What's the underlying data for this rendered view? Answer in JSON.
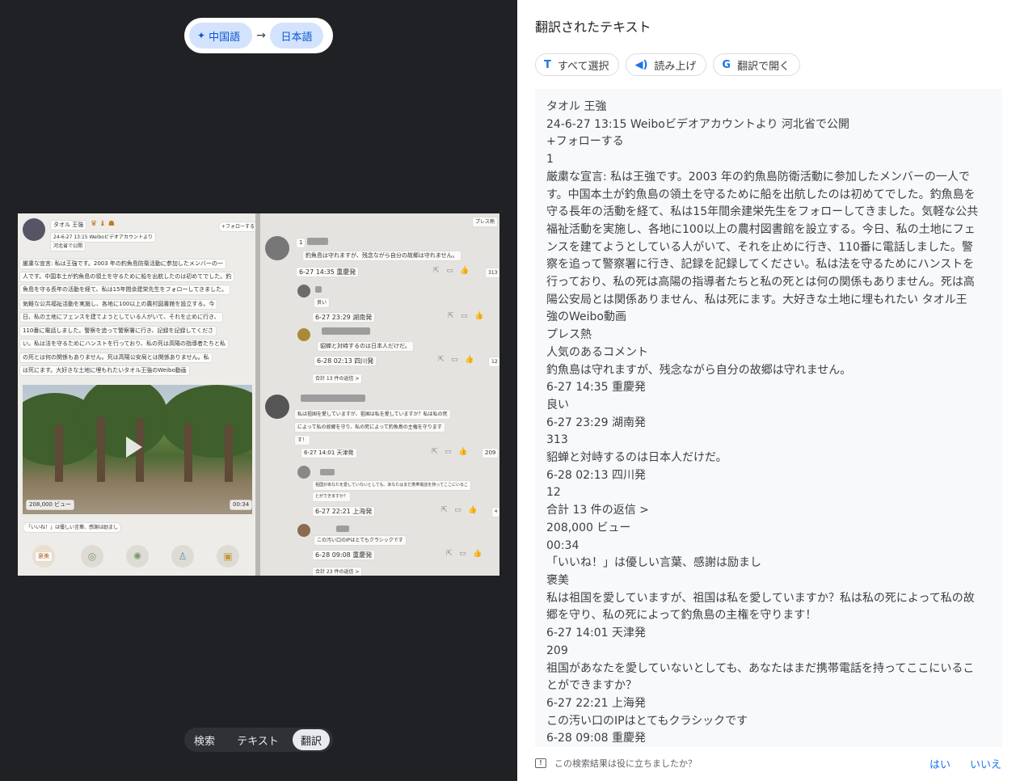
{
  "language_selector": {
    "source": "中国語",
    "arrow": "→",
    "target": "日本語"
  },
  "image_overlay": {
    "author": "タオル 王強",
    "meta": "24-6-27 13:15 Weiboビデオアカウントより",
    "location": "河北省で公開",
    "follow": "+フォローする",
    "post_lines": [
      "厳粛な宣言: 私は王強です。2003 年の釣魚島防衛活動に参加したメンバーの一",
      "人です。中国本土が釣魚島の領土を守るために船を出航したのは初めてでした。釣",
      "魚島を守る長年の活動を経て、私は15年間余建栄先生をフォローしてきました。",
      "気軽な公共福祉活動を実施し、各地に100以上の農村図書館を設立する。今",
      "日、私の土地にフェンスを建てようとしている人がいて、それを止めに行き、",
      "110番に電話しました。警察を追って警察署に行き、記録を記録してくださ",
      "い。私は法を守るためにハンストを行っており、私の死は高陽の指導者たちと私",
      "の死とは何の関係もありません。死は高陽公安局とは関係ありません。私",
      "は死にます。大好きな土地に埋もれたいタオル王強のWeibo動画"
    ],
    "views": "208,000 ビュー",
    "duration": "00:34",
    "like_caption": "「いいね！」は優しい言葉、感謝は励まし",
    "praise": "褒美",
    "hot": "プレス熱",
    "comments": [
      {
        "rank": "1",
        "text": "釣魚島は守れますが、残念ながら自分の故郷は守れません。",
        "meta": "6-27 14:35 重慶発",
        "count": "313"
      },
      {
        "text": "良い",
        "meta": "6-27 23:29 湖南発",
        "count": ""
      },
      {
        "text": "貂蝉と対峙するのは日本人だけだ。",
        "meta": "6-28 02:13 四川発",
        "count": "12"
      },
      {
        "text": "合計 13 件の返信 >",
        "meta": "",
        "count": ""
      },
      {
        "text": "私は祖国を愛していますが、祖国は私を愛していますか？私は私の死",
        "text2": "によって私の故郷を守り、私の死によって釣魚島の主権を守ります",
        "text3": "す！",
        "meta": "6-27 14:01 天津発",
        "count": "209"
      },
      {
        "text": "祖国があなたを愛していないとしても、あなたはまだ携帯電話を持ってここにいるこ",
        "text2": "とができますか？",
        "meta": "6-27 22:21 上海発",
        "count": "4"
      },
      {
        "text": "この汚い口のIPはとてもクラシックです",
        "meta": "6-28 09:08 重慶発",
        "count": ""
      },
      {
        "text": "合計 23 件の返信 >",
        "meta": "",
        "count": ""
      }
    ]
  },
  "mode_tabs": {
    "search": "検索",
    "text": "テキスト",
    "translate": "翻訳"
  },
  "panel": {
    "title": "翻訳されたテキスト",
    "select_all": "すべて選択",
    "read_aloud": "読み上げ",
    "open_translate": "翻訳で開く"
  },
  "translated_lines": [
    "タオル 王強",
    "24-6-27 13:15 Weiboビデオアカウントより 河北省で公開",
    "+フォローする",
    "1",
    "厳粛な宣言: 私は王強です。2003 年の釣魚島防衛活動に参加したメンバーの一人で",
    "す。中国本土が釣魚島の領土を守るために船を出航したのは初めてでした。釣魚島を",
    "守る長年の活動を経て、私は15年間余建栄先生をフォローしてきました。気軽な公共",
    "福祉活動を実施し、各地に100以上の農村図書館を設立する。今日、私の土地にフェ",
    "ンスを建てようとしている人がいて、それを止めに行き、110番に電話しました。警",
    "察を追って警察署に行き、記録を記録してください。私は法を守るためにハンストを",
    "行っており、私の死は高陽の指導者たちと私の死とは何の関係もありません。死は高",
    "陽公安局とは関係ありません、私は死にます。大好きな土地に埋もれたい タオル王",
    "強のWeibo動画",
    "プレス熱",
    "人気のあるコメント",
    "釣魚島は守れますが、残念ながら自分の故郷は守れません。",
    "6-27 14:35 重慶発",
    "良い",
    "6-27 23:29 湖南発",
    "313",
    "貂蝉と対峙するのは日本人だけだ。",
    "6-28 02:13 四川発",
    "12",
    "合計 13 件の返信 >",
    "208,000 ビュー",
    "00:34",
    "「いいね！」は優しい言葉、感謝は励まし",
    "褒美",
    "私は祖国を愛していますが、祖国は私を愛していますか？私は私の死によって私の故",
    "郷を守り、私の死によって釣魚島の主権を守ります！",
    "6-27 14:01 天津発",
    "209",
    "祖国があなたを愛していないとしても、あなたはまだ携帯電話を持ってここにいるこ",
    "とができますか？",
    "6-27 22:21 上海発",
    "この汚い口のIPはとてもクラシックです",
    "6-28 09:08 重慶発"
  ],
  "feedback": {
    "question": "この検索結果は役に立ちましたか？",
    "yes": "はい",
    "no": "いいえ"
  }
}
